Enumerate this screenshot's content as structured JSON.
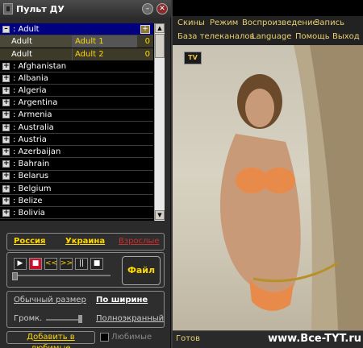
{
  "window": {
    "title": "Пульт ДУ"
  },
  "tree": {
    "root_label": ": Adult",
    "sub_rows": [
      {
        "name": "Adult",
        "channel": "Adult 1",
        "count": "0"
      },
      {
        "name": "Adult",
        "channel": "Adult 2",
        "count": "0"
      }
    ],
    "groups": [
      ": Afghanistan",
      ": Albania",
      ": Algeria",
      ": Argentina",
      ": Armenia",
      ": Australia",
      ": Austria",
      ": Azerbaijan",
      ": Bahrain",
      ": Belarus",
      ": Belgium",
      ": Belize",
      ": Bolivia"
    ]
  },
  "controls": {
    "lang_russia": "Россия",
    "lang_ukraine": "Украина",
    "lang_adult": "Взрослые",
    "play_buttons": [
      "▶",
      "■",
      "<<",
      ">>",
      "||",
      "■"
    ],
    "file_label": "Файл",
    "size_normal": "Обычный размер",
    "size_width": "По ширине",
    "volume_label": "Громк.",
    "fullscreen": "Полноэкранный",
    "add_favorite": "Добавить в любимые",
    "favorites_label": "Любимые",
    "colors": {
      "accent": "#ffd800",
      "stop": "#c8102e",
      "adult": "#c83030"
    }
  },
  "player": {
    "menu": [
      "Скины",
      "Режим",
      "Воспроизведение",
      "Запись",
      "База телеканалов",
      "Language",
      "Помощь",
      "Выход"
    ],
    "logo_text": "TV",
    "status": "Готов",
    "watermark": "www.Bce-TYT.ru"
  }
}
